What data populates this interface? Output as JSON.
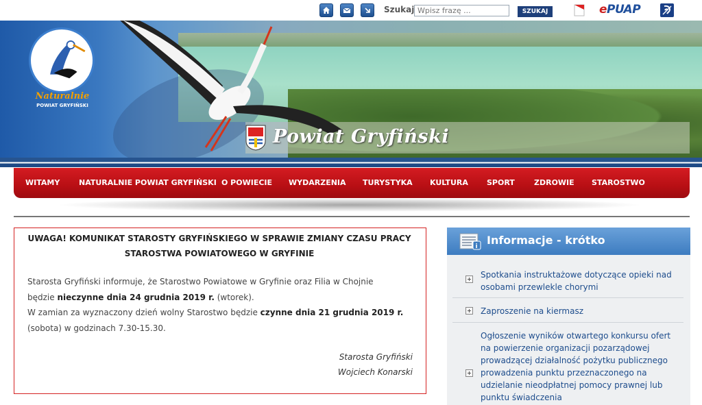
{
  "toolbar": {
    "icons": [
      "home-icon",
      "mail-icon",
      "sitemap-icon"
    ],
    "search_label": "Szukaj",
    "search_placeholder": "Wpisz frazę ...",
    "search_button": "SZUKAJ",
    "epuap_prefix": "e",
    "epuap_rest": "PUAP"
  },
  "banner": {
    "logo_text": "Naturalnie",
    "logo_subtext": "POWIAT GRYFIŃSKI",
    "title": "Powiat Gryfiński"
  },
  "nav": {
    "items": [
      "WITAMY",
      "NATURALNIE POWIAT GRYFIŃSKI",
      "O POWIECIE",
      "WYDARZENIA",
      "TURYSTYKA",
      "KULTURA",
      "SPORT",
      "ZDROWIE",
      "STAROSTWO"
    ]
  },
  "notice": {
    "title_line1": "UWAGA! KOMUNIKAT STAROSTY GRYFIŃSKIEGO W SPRAWIE ZMIANY CZASU PRACY",
    "title_line2": "STAROSTWA POWIATOWEGO W GRYFINIE",
    "p1_part1": "Starosta Gryfiński informuje, że Starostwo Powiatowe w Gryfinie oraz Filia w Chojnie",
    "p1_part2": "będzie ",
    "p1_bold": "nieczynne dnia 24 grudnia 2019 r.",
    "p1_part3": " (wtorek).",
    "p2_part1": "W zamian za wyznaczony dzień wolny Starostwo będzie ",
    "p2_bold": "czynne dnia 21 grudnia 2019 r.",
    "p2_part2": "(sobota) w godzinach 7.30-15.30.",
    "signature_role": "Starosta Gryfiński",
    "signature_name": "Wojciech Konarski"
  },
  "sidebar": {
    "title": "Informacje - krótko",
    "items": [
      "Spotkania instruktażowe dotyczące opieki nad osobami przewlekle chorymi",
      "Zaproszenie na kiermasz",
      "Ogłoszenie wyników otwartego konkursu ofert na powierzenie organizacji pozarządowej prowadzącej działalność pożytku publicznego prowadzenia punktu przeznaczonego na udzielanie nieodpłatnej pomocy prawnej lub punktu świadczenia"
    ]
  }
}
